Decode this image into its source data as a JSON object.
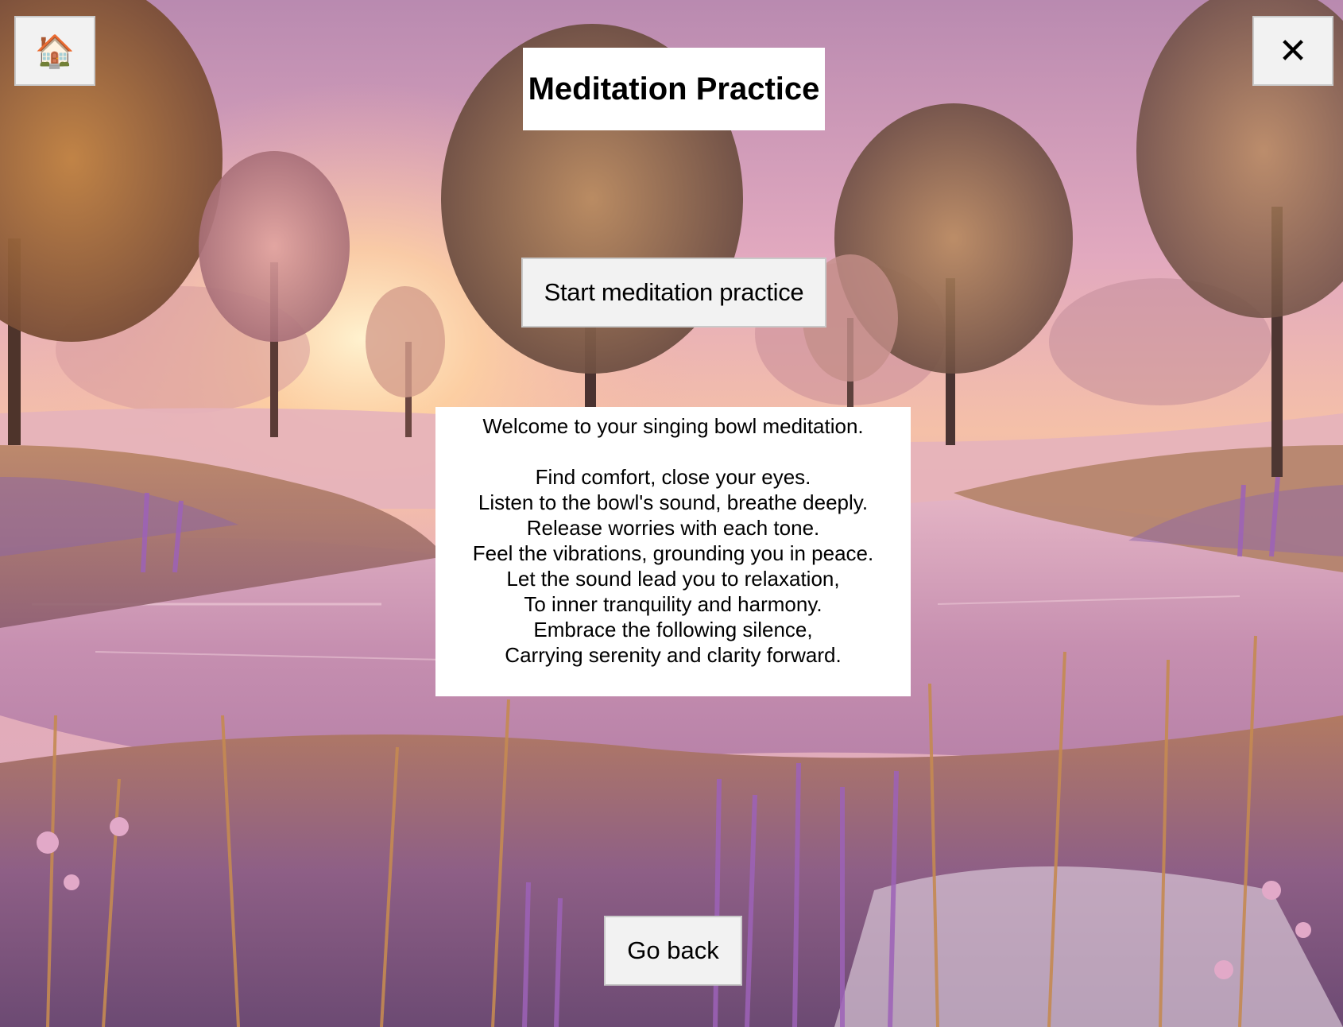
{
  "window": {
    "home_icon": "🏠",
    "close_icon": "✕"
  },
  "title": "Meditation Practice",
  "start_button": "Start meditation practice",
  "intro": {
    "greeting": "Welcome to your singing bowl meditation.",
    "lines": [
      "Find comfort, close your eyes.",
      "Listen to the bowl's sound, breathe deeply.",
      "Release worries with each tone.",
      "Feel the vibrations, grounding you in peace.",
      "Let the sound lead you to relaxation,",
      "To inner tranquility and harmony.",
      "Embrace the following silence,",
      "Carrying serenity and clarity forward."
    ]
  },
  "back_button": "Go back",
  "colors": {
    "sky_top": "#c98fb4",
    "sky_glow": "#f7c6a4",
    "water": "#c98fb1",
    "grass": "#b9845a",
    "lavender": "#8a5aa8",
    "panel": "#ffffff",
    "button": "#f2f2f2"
  }
}
